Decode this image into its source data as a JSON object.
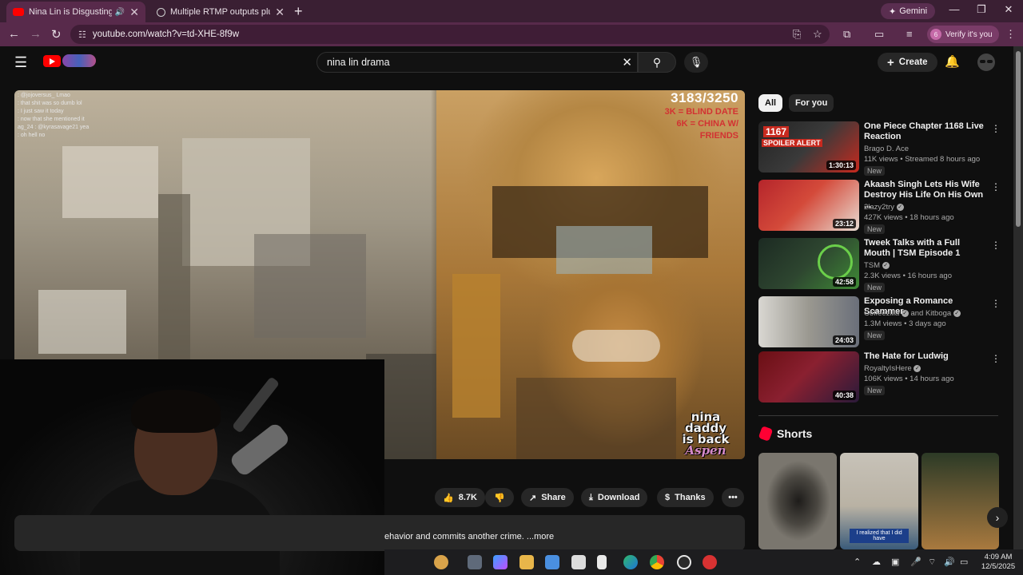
{
  "browser": {
    "tabs": [
      {
        "title": "Nina Lin is Disgusting - You",
        "active": true,
        "favicon_color": "#ff0000"
      },
      {
        "title": "Multiple RTMP outputs plugin |",
        "active": false,
        "favicon_color": "#cfcfcf"
      }
    ],
    "gemini_label": "Gemini",
    "url": "youtube.com/watch?v=td-XHE-8f9w",
    "verify_label": "Verify it's you",
    "verify_badge": "6"
  },
  "youtube": {
    "search_value": "nina lin drama",
    "create_label": "Create"
  },
  "video": {
    "chat": [
      ": @jojoversus_ Lmao",
      ": that shit was so dumb lol",
      ": I just saw it today",
      ": now that she mentioned it",
      "ag_24 : @kyrasavage21 yea",
      ": oh hell no"
    ],
    "counter": "3183/3250",
    "goals": [
      "3K = BLIND DATE",
      "6K = CHINA W/",
      "FRIENDS"
    ],
    "watermark": [
      "nina",
      "daddy",
      "is back"
    ],
    "watermark_sig": "Aspen"
  },
  "actions": {
    "likes": "8.7K",
    "share": "Share",
    "download": "Download",
    "thanks": "Thanks"
  },
  "description": {
    "snippet": "ehavior and commits another crime. ...more"
  },
  "sidebar": {
    "chips": [
      "All",
      "For you"
    ],
    "recs": [
      {
        "title": "One Piece Chapter 1168 Live Reaction",
        "channel": "Brago D. Ace",
        "meta": "11K views • Streamed 8 hours ago",
        "duration": "1:30:13",
        "badge": "New",
        "thumb_overlay": "1167",
        "thumb_banner": "SPOILER ALERT",
        "colors": [
          "#2b2b2b",
          "#c8291e"
        ]
      },
      {
        "title": "Akaash Singh Lets His Wife Destroy His Life On His Own ...",
        "channel": "2lazy2try",
        "meta": "427K views • 18 hours ago",
        "duration": "23:12",
        "badge": "New",
        "colors": [
          "#b5252b",
          "#e8dcd2"
        ]
      },
      {
        "title": "Tweek Talks with a Full Mouth | TSM Episode 1",
        "channel": "TSM",
        "meta": "2.3K views • 16 hours ago",
        "duration": "42:58",
        "badge": "New",
        "colors": [
          "#1c2a22",
          "#3f8a36"
        ]
      },
      {
        "title": "Exposing a Romance Scammer",
        "channel": "Coffeezilla",
        "channel2": "Kitboga",
        "meta": "1.3M views • 3 days ago",
        "duration": "24:03",
        "badge": "New",
        "colors": [
          "#d9d7d2",
          "#6a6f7a"
        ]
      },
      {
        "title": "The Hate for Ludwig",
        "channel": "RoyaltyIsHere",
        "meta": "106K views • 14 hours ago",
        "duration": "40:38",
        "badge": "New",
        "colors": [
          "#6a0f14",
          "#2a1a3a"
        ]
      }
    ],
    "shorts_heading": "Shorts",
    "shorts": [
      {
        "caption": "",
        "colors": [
          "#6e6a63",
          "#2f2d2a"
        ]
      },
      {
        "caption": "I realized that I did have",
        "colors": [
          "#3a5b7a",
          "#c7c2b8"
        ]
      },
      {
        "caption": "",
        "colors": [
          "#a8793e",
          "#2c3a26"
        ]
      }
    ]
  },
  "taskbar": {
    "time": "4:09 AM",
    "date": "12/5/2025"
  }
}
